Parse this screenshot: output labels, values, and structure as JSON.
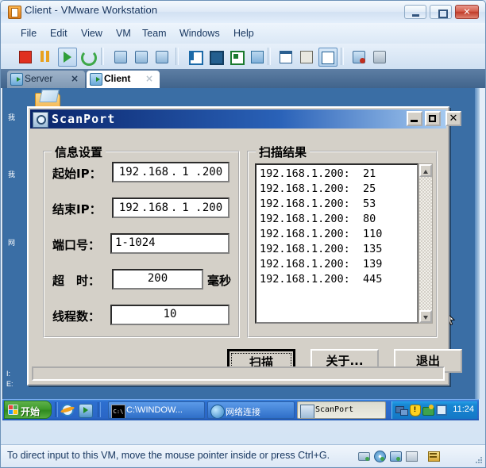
{
  "vmware": {
    "title": "Client - VMware Workstation",
    "title_icon": "vmware-icon",
    "window_buttons": {
      "minimize": "minimize-icon",
      "maximize": "maximize-icon",
      "close": "close-icon"
    },
    "menus": [
      "File",
      "Edit",
      "View",
      "VM",
      "Team",
      "Windows",
      "Help"
    ],
    "toolbar_icons": [
      "power-off-icon",
      "suspend-icon",
      "power-on-icon",
      "reset-icon",
      "snapshot-icon",
      "revert-snapshot-icon",
      "snapshot-manager-icon",
      "show-sidebar-icon",
      "fullscreen-icon",
      "quick-switch-icon",
      "unity-icon",
      "summary-view-icon",
      "console-view-icon",
      "multiple-view-icon",
      "clone-icon",
      "team-icon"
    ],
    "tabs": [
      {
        "label": "Server",
        "icon": "vm-tab-icon",
        "close": "×",
        "active": false
      },
      {
        "label": "Client",
        "icon": "vm-tab-icon",
        "close": "×",
        "active": true
      }
    ],
    "statusbar": {
      "message": "To direct input to this VM, move the mouse pointer inside or press Ctrl+G.",
      "icons": [
        "network-adapter-icon",
        "cd-drive-icon",
        "usb-icon",
        "floppy-icon",
        "display-icon"
      ]
    }
  },
  "guest_desktop": {
    "background_color": "#3a6ea5",
    "icons": [
      {
        "name": "folder-icon",
        "label": "我"
      },
      {
        "name": "help-icon",
        "label": ""
      }
    ],
    "partial_labels": [
      "我",
      "我",
      "网",
      "I:",
      "E:"
    ],
    "cursor": "arrow-cursor"
  },
  "taskbar": {
    "start_label": "开始",
    "start_icon": "windows-flag-icon",
    "quicklaunch": [
      "internet-explorer-icon",
      "show-desktop-icon"
    ],
    "tasks": [
      {
        "label": "C:\\WINDOW...",
        "icon": "cmd-icon",
        "active": false
      },
      {
        "label": "网络连接",
        "icon": "network-connections-icon",
        "active": false
      },
      {
        "label": "ScanPort",
        "icon": "scanport-icon",
        "active": true
      }
    ],
    "tray_icons": [
      "network-icon",
      "security-alert-icon",
      "updates-icon",
      "vmware-tools-icon"
    ],
    "clock": "11:24"
  },
  "dialog": {
    "title": "ScanPort",
    "icon": "magnifier-icon",
    "buttons": {
      "minimize": "_",
      "maximize": "□",
      "close": "✕"
    },
    "settings_group": {
      "title": "信息设置",
      "fields": [
        {
          "label": "起始IP：",
          "name": "start-ip-field",
          "type": "ip",
          "value": "192.168.1.200",
          "segments": [
            "192",
            "168",
            "1",
            "200"
          ]
        },
        {
          "label": "结束IP：",
          "name": "end-ip-field",
          "type": "ip",
          "value": "192.168.1.200",
          "segments": [
            "192",
            "168",
            "1",
            "200"
          ]
        },
        {
          "label": "端口号：",
          "name": "port-range-field",
          "type": "text",
          "value": "1-1024",
          "align": "left"
        },
        {
          "label": "超　时：",
          "name": "timeout-field",
          "type": "text",
          "value": "200",
          "align": "center",
          "suffix": "毫秒"
        },
        {
          "label": "线程数：",
          "name": "thread-count-field",
          "type": "text",
          "value": "10",
          "align": "center"
        }
      ]
    },
    "results_group": {
      "title": "扫描结果",
      "rows": [
        "192.168.1.200:  21",
        "192.168.1.200:  25",
        "192.168.1.200:  53",
        "192.168.1.200:  80",
        "192.168.1.200:  110",
        "192.168.1.200:  135",
        "192.168.1.200:  139",
        "192.168.1.200:  445"
      ],
      "scrollbar": {
        "up": "scroll-up-icon",
        "down": "scroll-down-icon"
      }
    },
    "actions": [
      {
        "label": "扫描",
        "name": "scan-button",
        "focused": true
      },
      {
        "label": "关于...",
        "name": "about-button",
        "focused": false
      },
      {
        "label": "退出",
        "name": "exit-button",
        "focused": false
      }
    ]
  }
}
